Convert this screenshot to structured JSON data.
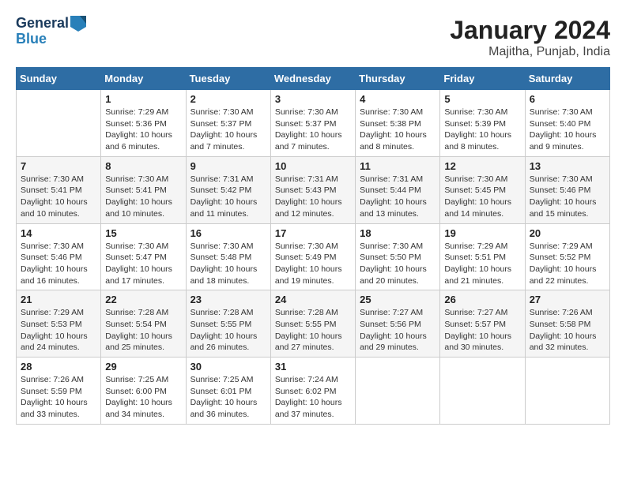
{
  "header": {
    "logo_line1": "General",
    "logo_line2": "Blue",
    "title": "January 2024",
    "subtitle": "Majitha, Punjab, India"
  },
  "calendar": {
    "days_of_week": [
      "Sunday",
      "Monday",
      "Tuesday",
      "Wednesday",
      "Thursday",
      "Friday",
      "Saturday"
    ],
    "weeks": [
      [
        {
          "date": "",
          "sunrise": "",
          "sunset": "",
          "daylight": ""
        },
        {
          "date": "1",
          "sunrise": "Sunrise: 7:29 AM",
          "sunset": "Sunset: 5:36 PM",
          "daylight": "Daylight: 10 hours and 6 minutes."
        },
        {
          "date": "2",
          "sunrise": "Sunrise: 7:30 AM",
          "sunset": "Sunset: 5:37 PM",
          "daylight": "Daylight: 10 hours and 7 minutes."
        },
        {
          "date": "3",
          "sunrise": "Sunrise: 7:30 AM",
          "sunset": "Sunset: 5:37 PM",
          "daylight": "Daylight: 10 hours and 7 minutes."
        },
        {
          "date": "4",
          "sunrise": "Sunrise: 7:30 AM",
          "sunset": "Sunset: 5:38 PM",
          "daylight": "Daylight: 10 hours and 8 minutes."
        },
        {
          "date": "5",
          "sunrise": "Sunrise: 7:30 AM",
          "sunset": "Sunset: 5:39 PM",
          "daylight": "Daylight: 10 hours and 8 minutes."
        },
        {
          "date": "6",
          "sunrise": "Sunrise: 7:30 AM",
          "sunset": "Sunset: 5:40 PM",
          "daylight": "Daylight: 10 hours and 9 minutes."
        }
      ],
      [
        {
          "date": "7",
          "sunrise": "Sunrise: 7:30 AM",
          "sunset": "Sunset: 5:41 PM",
          "daylight": "Daylight: 10 hours and 10 minutes."
        },
        {
          "date": "8",
          "sunrise": "Sunrise: 7:30 AM",
          "sunset": "Sunset: 5:41 PM",
          "daylight": "Daylight: 10 hours and 10 minutes."
        },
        {
          "date": "9",
          "sunrise": "Sunrise: 7:31 AM",
          "sunset": "Sunset: 5:42 PM",
          "daylight": "Daylight: 10 hours and 11 minutes."
        },
        {
          "date": "10",
          "sunrise": "Sunrise: 7:31 AM",
          "sunset": "Sunset: 5:43 PM",
          "daylight": "Daylight: 10 hours and 12 minutes."
        },
        {
          "date": "11",
          "sunrise": "Sunrise: 7:31 AM",
          "sunset": "Sunset: 5:44 PM",
          "daylight": "Daylight: 10 hours and 13 minutes."
        },
        {
          "date": "12",
          "sunrise": "Sunrise: 7:30 AM",
          "sunset": "Sunset: 5:45 PM",
          "daylight": "Daylight: 10 hours and 14 minutes."
        },
        {
          "date": "13",
          "sunrise": "Sunrise: 7:30 AM",
          "sunset": "Sunset: 5:46 PM",
          "daylight": "Daylight: 10 hours and 15 minutes."
        }
      ],
      [
        {
          "date": "14",
          "sunrise": "Sunrise: 7:30 AM",
          "sunset": "Sunset: 5:46 PM",
          "daylight": "Daylight: 10 hours and 16 minutes."
        },
        {
          "date": "15",
          "sunrise": "Sunrise: 7:30 AM",
          "sunset": "Sunset: 5:47 PM",
          "daylight": "Daylight: 10 hours and 17 minutes."
        },
        {
          "date": "16",
          "sunrise": "Sunrise: 7:30 AM",
          "sunset": "Sunset: 5:48 PM",
          "daylight": "Daylight: 10 hours and 18 minutes."
        },
        {
          "date": "17",
          "sunrise": "Sunrise: 7:30 AM",
          "sunset": "Sunset: 5:49 PM",
          "daylight": "Daylight: 10 hours and 19 minutes."
        },
        {
          "date": "18",
          "sunrise": "Sunrise: 7:30 AM",
          "sunset": "Sunset: 5:50 PM",
          "daylight": "Daylight: 10 hours and 20 minutes."
        },
        {
          "date": "19",
          "sunrise": "Sunrise: 7:29 AM",
          "sunset": "Sunset: 5:51 PM",
          "daylight": "Daylight: 10 hours and 21 minutes."
        },
        {
          "date": "20",
          "sunrise": "Sunrise: 7:29 AM",
          "sunset": "Sunset: 5:52 PM",
          "daylight": "Daylight: 10 hours and 22 minutes."
        }
      ],
      [
        {
          "date": "21",
          "sunrise": "Sunrise: 7:29 AM",
          "sunset": "Sunset: 5:53 PM",
          "daylight": "Daylight: 10 hours and 24 minutes."
        },
        {
          "date": "22",
          "sunrise": "Sunrise: 7:28 AM",
          "sunset": "Sunset: 5:54 PM",
          "daylight": "Daylight: 10 hours and 25 minutes."
        },
        {
          "date": "23",
          "sunrise": "Sunrise: 7:28 AM",
          "sunset": "Sunset: 5:55 PM",
          "daylight": "Daylight: 10 hours and 26 minutes."
        },
        {
          "date": "24",
          "sunrise": "Sunrise: 7:28 AM",
          "sunset": "Sunset: 5:55 PM",
          "daylight": "Daylight: 10 hours and 27 minutes."
        },
        {
          "date": "25",
          "sunrise": "Sunrise: 7:27 AM",
          "sunset": "Sunset: 5:56 PM",
          "daylight": "Daylight: 10 hours and 29 minutes."
        },
        {
          "date": "26",
          "sunrise": "Sunrise: 7:27 AM",
          "sunset": "Sunset: 5:57 PM",
          "daylight": "Daylight: 10 hours and 30 minutes."
        },
        {
          "date": "27",
          "sunrise": "Sunrise: 7:26 AM",
          "sunset": "Sunset: 5:58 PM",
          "daylight": "Daylight: 10 hours and 32 minutes."
        }
      ],
      [
        {
          "date": "28",
          "sunrise": "Sunrise: 7:26 AM",
          "sunset": "Sunset: 5:59 PM",
          "daylight": "Daylight: 10 hours and 33 minutes."
        },
        {
          "date": "29",
          "sunrise": "Sunrise: 7:25 AM",
          "sunset": "Sunset: 6:00 PM",
          "daylight": "Daylight: 10 hours and 34 minutes."
        },
        {
          "date": "30",
          "sunrise": "Sunrise: 7:25 AM",
          "sunset": "Sunset: 6:01 PM",
          "daylight": "Daylight: 10 hours and 36 minutes."
        },
        {
          "date": "31",
          "sunrise": "Sunrise: 7:24 AM",
          "sunset": "Sunset: 6:02 PM",
          "daylight": "Daylight: 10 hours and 37 minutes."
        },
        {
          "date": "",
          "sunrise": "",
          "sunset": "",
          "daylight": ""
        },
        {
          "date": "",
          "sunrise": "",
          "sunset": "",
          "daylight": ""
        },
        {
          "date": "",
          "sunrise": "",
          "sunset": "",
          "daylight": ""
        }
      ]
    ]
  }
}
